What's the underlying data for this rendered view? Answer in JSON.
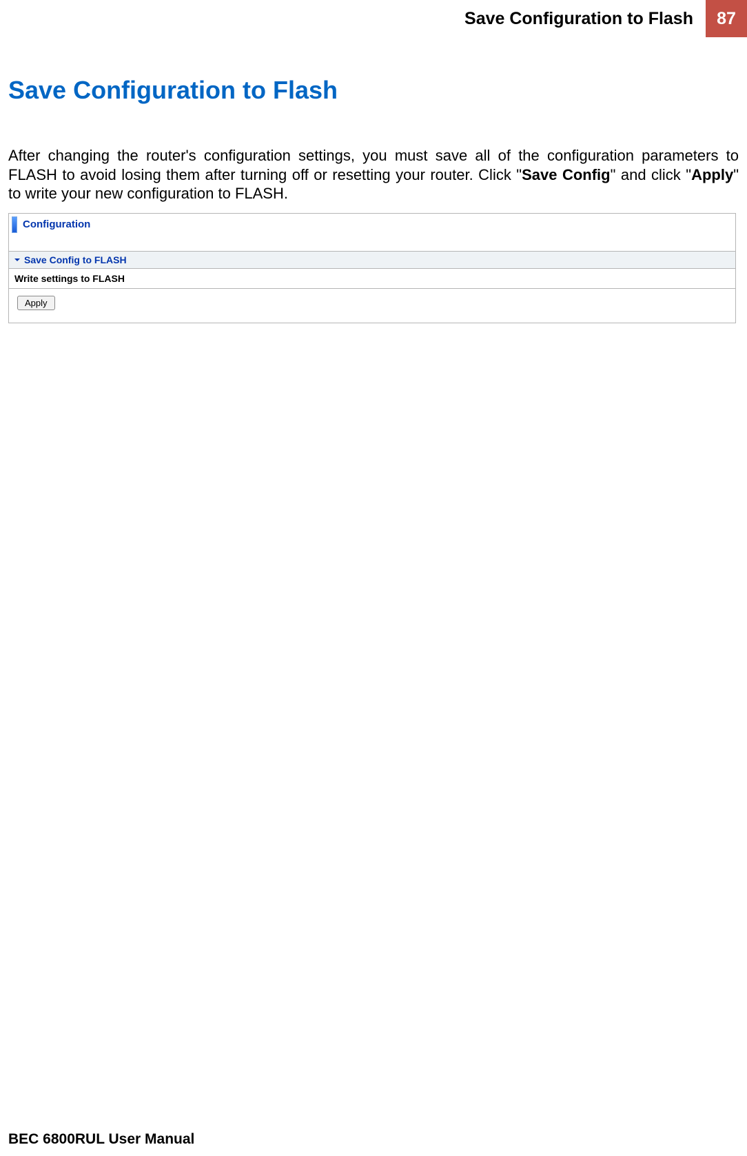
{
  "header": {
    "title": "Save Configuration to Flash",
    "page_number": "87"
  },
  "main": {
    "title": "Save Configuration to Flash",
    "para_part1": "After changing the router's configuration settings, you must save all of the configuration parameters to FLASH to avoid losing them after turning off or resetting your router. Click \"",
    "para_bold1": "Save Config",
    "para_part2": "\" and click \"",
    "para_bold2": "Apply",
    "para_part3": "\" to write your new configuration to FLASH."
  },
  "panel": {
    "header": "Configuration",
    "section": "Save Config to FLASH",
    "description": "Write settings to FLASH",
    "button": "Apply"
  },
  "footer": {
    "text": "BEC 6800RUL User Manual"
  }
}
